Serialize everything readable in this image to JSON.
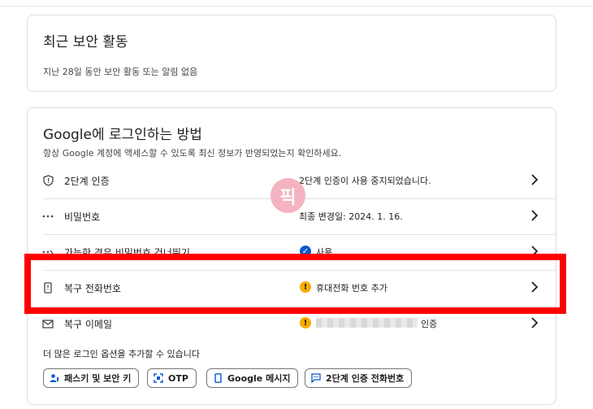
{
  "security_activity": {
    "title": "최근 보안 활동",
    "description": "지난 28일 동안 보안 활동 또는 알림 없음"
  },
  "signin": {
    "title": "Google에 로그인하는 방법",
    "subtitle": "항상 Google 계정에 액세스할 수 있도록 최신 정보가 반영되었는지 확인하세요.",
    "rows": [
      {
        "label": "2단계 인증",
        "value": "2단계 인증이 사용 중지되었습니다.",
        "icon": "shield-icon"
      },
      {
        "label": "비밀번호",
        "value": "최종 변경일: 2024. 1. 16.",
        "icon": "password-dots-icon"
      },
      {
        "label": "가능한 경우 비밀번호 건너뛰기",
        "value": "사용",
        "icon": "passkey-icon"
      },
      {
        "label": "복구 전화번호",
        "value": "휴대전화 번호 추가",
        "icon": "phone-icon"
      },
      {
        "label": "복구 이메일",
        "value": "인증",
        "icon": "mail-icon"
      }
    ],
    "more_options": "더 많은 로그인 옵션을 추가할 수 있습니다",
    "chips": [
      {
        "label": "패스키 및 보안 키",
        "icon": "person-key-icon"
      },
      {
        "label": "OTP",
        "icon": "qr-scan-icon"
      },
      {
        "label": "Google 메시지",
        "icon": "smartphone-icon"
      },
      {
        "label": "2단계 인증 전화번호",
        "icon": "message-icon"
      }
    ]
  },
  "watermark": {
    "text": "픽"
  },
  "colors": {
    "highlight": "#ff0000",
    "warning": "#f9ab00",
    "verified": "#0b57d0",
    "watermark": "#f3a6b6"
  }
}
